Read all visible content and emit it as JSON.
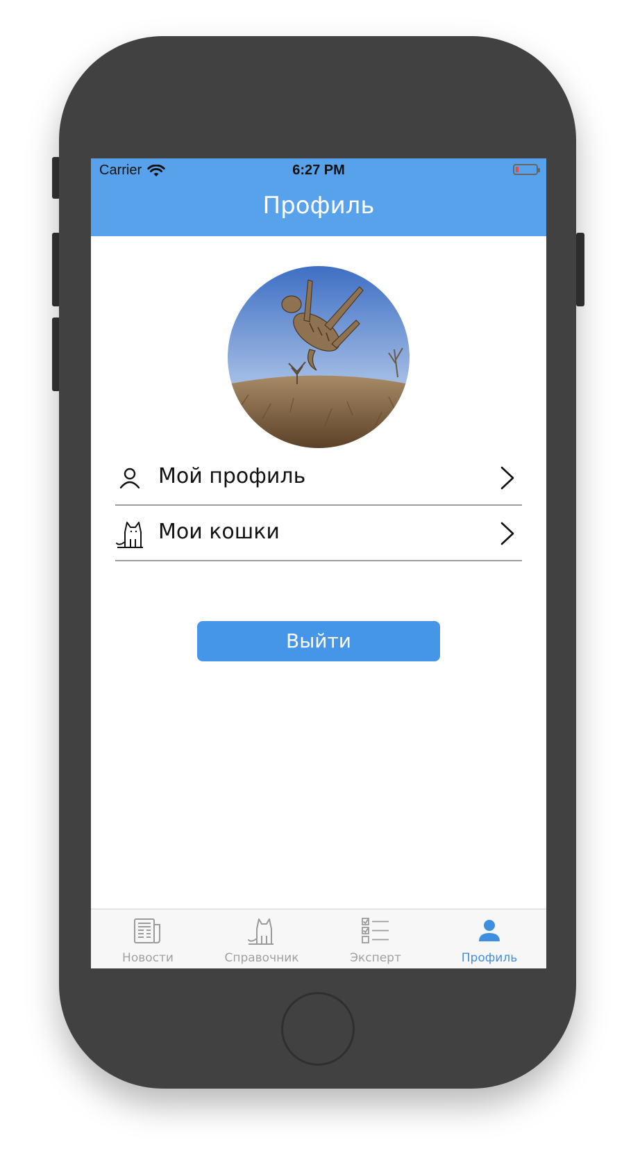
{
  "status_bar": {
    "carrier": "Carrier",
    "time": "6:27 PM"
  },
  "navbar": {
    "title": "Профиль"
  },
  "menu": {
    "items": [
      {
        "label": "Мой профиль",
        "icon": "person-icon"
      },
      {
        "label": "Мои кошки",
        "icon": "cat-icon"
      }
    ]
  },
  "logout": {
    "label": "Выйти"
  },
  "tabbar": {
    "tabs": [
      {
        "label": "Новости",
        "icon": "newspaper-icon",
        "active": false
      },
      {
        "label": "Справочник",
        "icon": "cat-icon",
        "active": false
      },
      {
        "label": "Эксперт",
        "icon": "checklist-icon",
        "active": false
      },
      {
        "label": "Профиль",
        "icon": "person-icon",
        "active": true
      }
    ]
  },
  "colors": {
    "navbar": "#58a2ec",
    "accent": "#4596e8",
    "tab_active": "#3f8fe0",
    "tab_inactive": "#a0a0a0",
    "device": "#414141"
  }
}
